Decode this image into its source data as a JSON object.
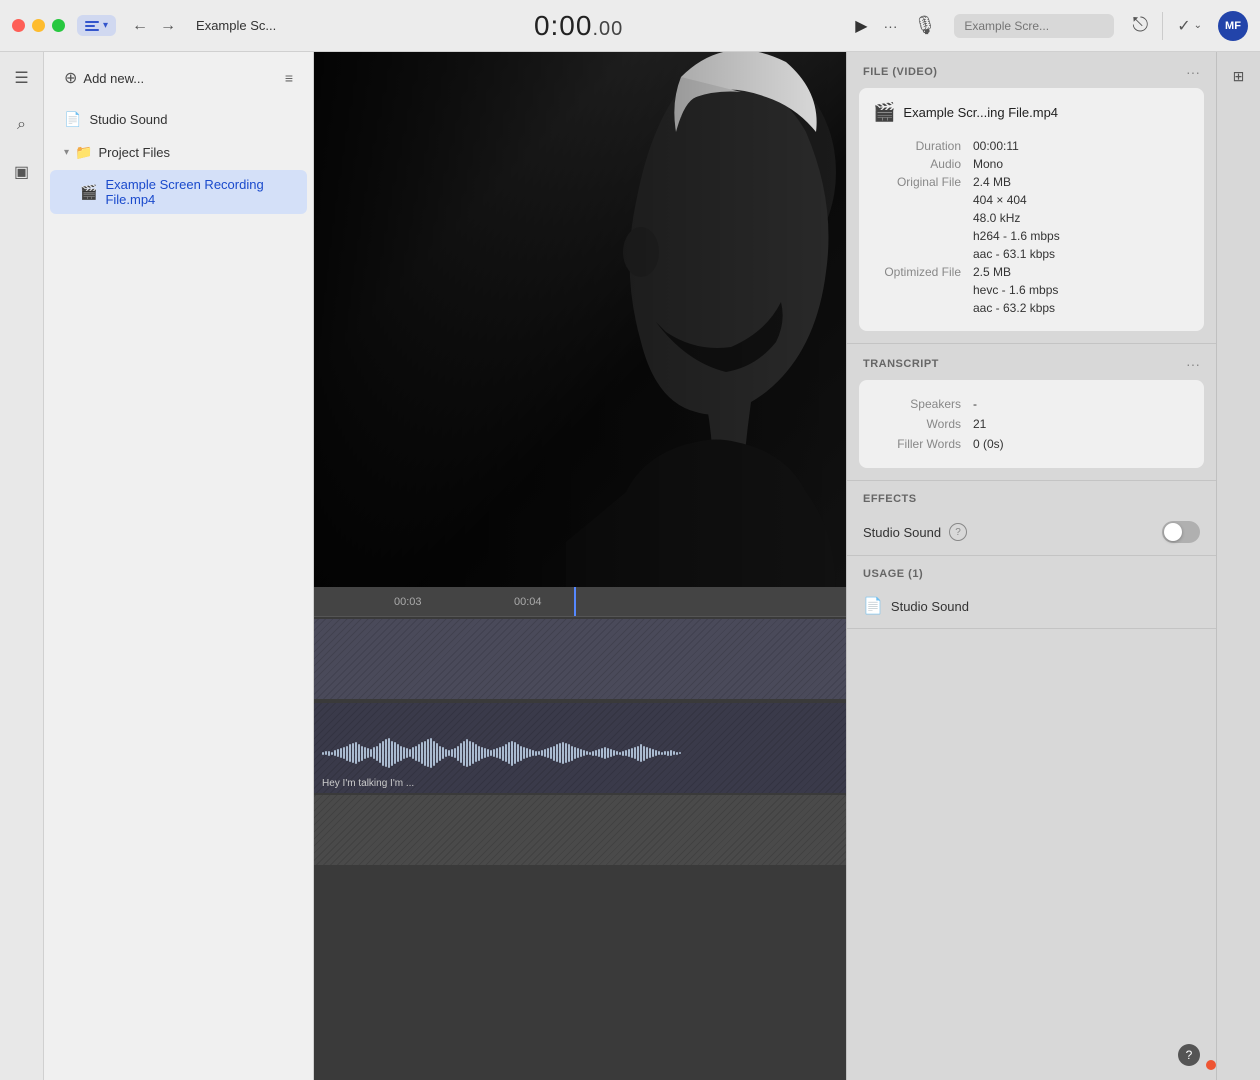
{
  "titlebar": {
    "window_title": "Example Sc...",
    "time": "0:00",
    "time_ms": ".00",
    "play_label": "▶",
    "more_label": "···",
    "search_placeholder": "Example Scre...",
    "back_icon": "←",
    "forward_icon": "→",
    "link_icon": "🔗",
    "check_icon": "✓",
    "chevron_icon": "⌄",
    "avatar_text": "MF"
  },
  "left_toolbar": {
    "menu_icon": "☰",
    "search_icon": "⌕",
    "library_icon": "▣"
  },
  "sidebar": {
    "add_new_label": "Add new...",
    "filter_icon": "≡",
    "items": [
      {
        "label": "Studio Sound",
        "type": "doc",
        "icon": "doc"
      },
      {
        "label": "Project Files",
        "type": "folder",
        "icon": "folder",
        "expanded": true
      },
      {
        "label": "Example Screen Recording File.mp4",
        "type": "video",
        "icon": "video",
        "active": true
      }
    ]
  },
  "right_panel": {
    "file_section": {
      "title": "FILE (VIDEO)",
      "file_name": "Example Scr...ing File.mp4",
      "duration_label": "Duration",
      "duration_value": "00:00:11",
      "audio_label": "Audio",
      "audio_value": "Mono",
      "original_file_label": "Original File",
      "original_size": "2.4 MB",
      "original_dims": "404 × 404",
      "original_rate": "48.0 kHz",
      "original_codec": "h264 - 1.6 mbps",
      "original_audio": "aac - 63.1 kbps",
      "optimized_file_label": "Optimized File",
      "optimized_size": "2.5 MB",
      "optimized_codec": "hevc - 1.6 mbps",
      "optimized_audio": "aac - 63.2 kbps"
    },
    "transcript_section": {
      "title": "TRANSCRIPT",
      "speakers_label": "Speakers",
      "speakers_value": "-",
      "words_label": "Words",
      "words_value": "21",
      "filler_words_label": "Filler Words",
      "filler_words_value": "0 (0s)"
    },
    "effects_section": {
      "title": "EFFECTS",
      "studio_sound_label": "Studio Sound",
      "help_icon": "?",
      "toggle_state": "off"
    },
    "usage_section": {
      "title": "USAGE (1)",
      "item_label": "Studio Sound",
      "doc_icon": "doc"
    }
  },
  "timeline": {
    "mark_1": "00:03",
    "mark_2": "00:04",
    "audio_caption": "Hey I'm  talking  I'm ..."
  }
}
